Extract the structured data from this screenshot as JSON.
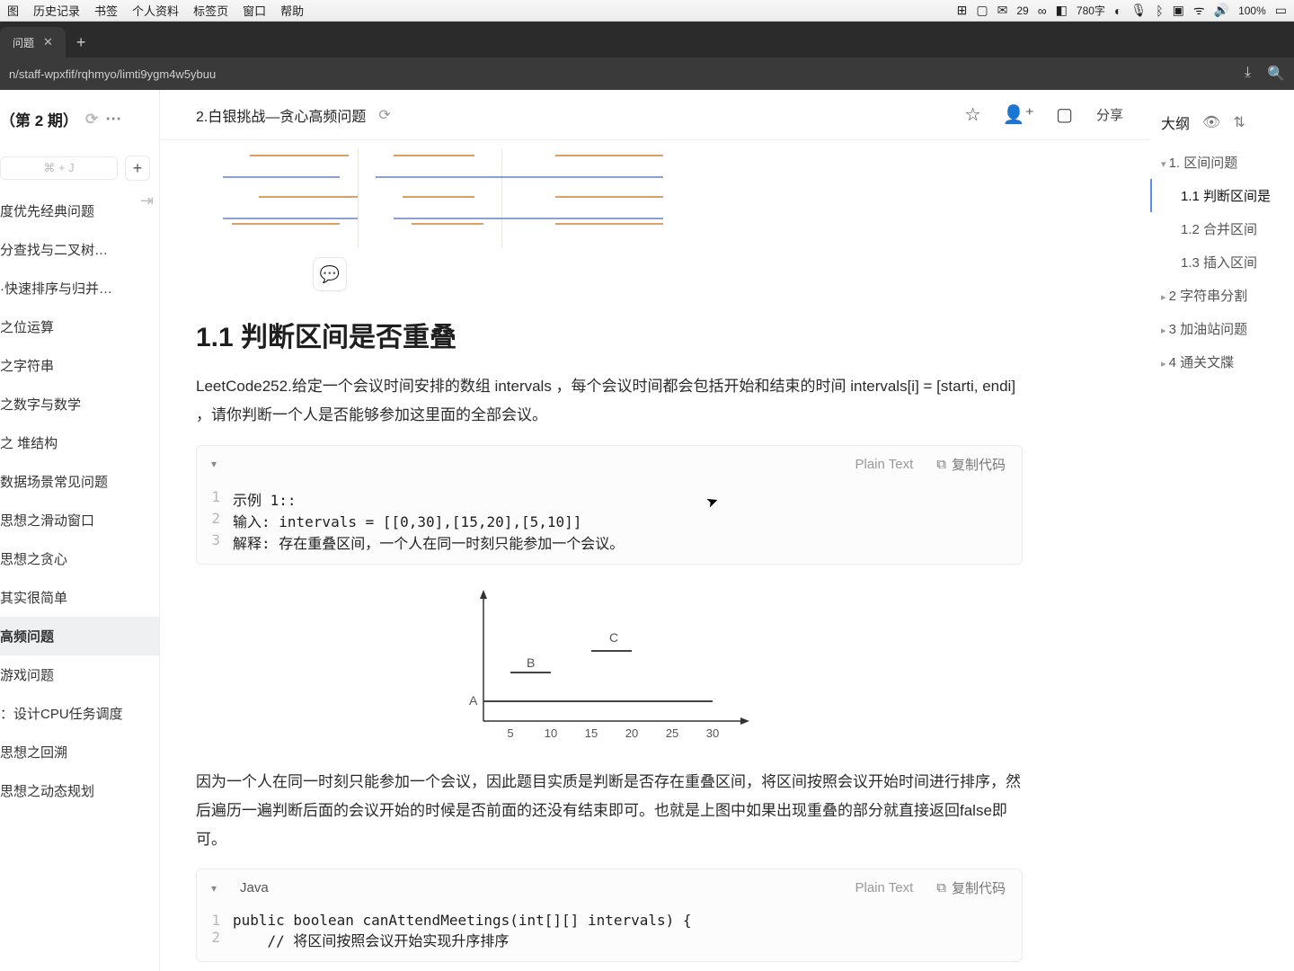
{
  "menubar": {
    "items": [
      "图",
      "历史记录",
      "书签",
      "个人资料",
      "标签页",
      "窗口",
      "帮助"
    ],
    "wechat_badge": "29",
    "word_count": "780字",
    "battery": "100%",
    "clock_icon": "🕐"
  },
  "browser": {
    "tab_title": "问题",
    "url": "n/staff-wpxfif/rqhmyo/limti9ygm4w5ybuu"
  },
  "left": {
    "title": "（第 2 期）",
    "kbd": "⌘ + J",
    "items": [
      "度优先经典问题",
      "分查找与二叉树…",
      "·快速排序与归并…",
      "之位运算",
      "之字符串",
      "之数字与数学",
      "之 堆结构",
      "数据场景常见问题",
      "思想之滑动窗口",
      "思想之贪心",
      "其实很简单",
      "高频问题",
      "游戏问题",
      "：设计CPU任务调度",
      "思想之回溯",
      "思想之动态规划"
    ],
    "active_index": 11
  },
  "doc": {
    "breadcrumb": "2.白银挑战—贪心高频问题",
    "share": "分享",
    "section_title": "1.1 判断区间是否重叠",
    "para1": "LeetCode252.给定一个会议时间安排的数组 intervals ，每个会议时间都会包括开始和结束的时间 intervals[i] = [starti, endi] ，请你判断一个人是否能够参加这里面的全部会议。",
    "para2": "因为一个人在同一时刻只能参加一个会议，因此题目实质是判断是否存在重叠区间，将区间按照会议开始时间进行排序，然后遍历一遍判断后面的会议开始的时候是否前面的还没有结束即可。也就是上图中如果出现重叠的部分就直接返回false即可。"
  },
  "code1": {
    "plain": "Plain Text",
    "copy": "复制代码",
    "lines": [
      "示例 1::",
      "输入: intervals = [[0,30],[15,20],[5,10]]",
      "解释: 存在重叠区间，一个人在同一时刻只能参加一个会议。"
    ]
  },
  "code2": {
    "lang": "Java",
    "plain": "Plain Text",
    "copy": "复制代码",
    "lines": [
      "public boolean canAttendMeetings(int[][] intervals) {",
      "    // 将区间按照会议开始实现升序排序"
    ]
  },
  "outline": {
    "label": "大纲",
    "items": [
      {
        "level": 1,
        "open": true,
        "text": "1. 区间问题"
      },
      {
        "level": 2,
        "active": true,
        "text": "1.1 判断区间是"
      },
      {
        "level": 2,
        "text": "1.2 合并区间"
      },
      {
        "level": 2,
        "text": "1.3 插入区间"
      },
      {
        "level": 1,
        "text": "2 字符串分割"
      },
      {
        "level": 1,
        "text": "3 加油站问题"
      },
      {
        "level": 1,
        "text": "4 通关文牒"
      }
    ]
  },
  "chart_data": {
    "type": "scatter",
    "title": "",
    "xlabel": "",
    "ylabel": "",
    "x_ticks": [
      5,
      10,
      15,
      20,
      25,
      30
    ],
    "series": [
      {
        "name": "A",
        "interval": [
          0,
          30
        ],
        "y": 1
      },
      {
        "name": "B",
        "interval": [
          5,
          10
        ],
        "y": 2
      },
      {
        "name": "C",
        "interval": [
          15,
          20
        ],
        "y": 3
      }
    ]
  }
}
